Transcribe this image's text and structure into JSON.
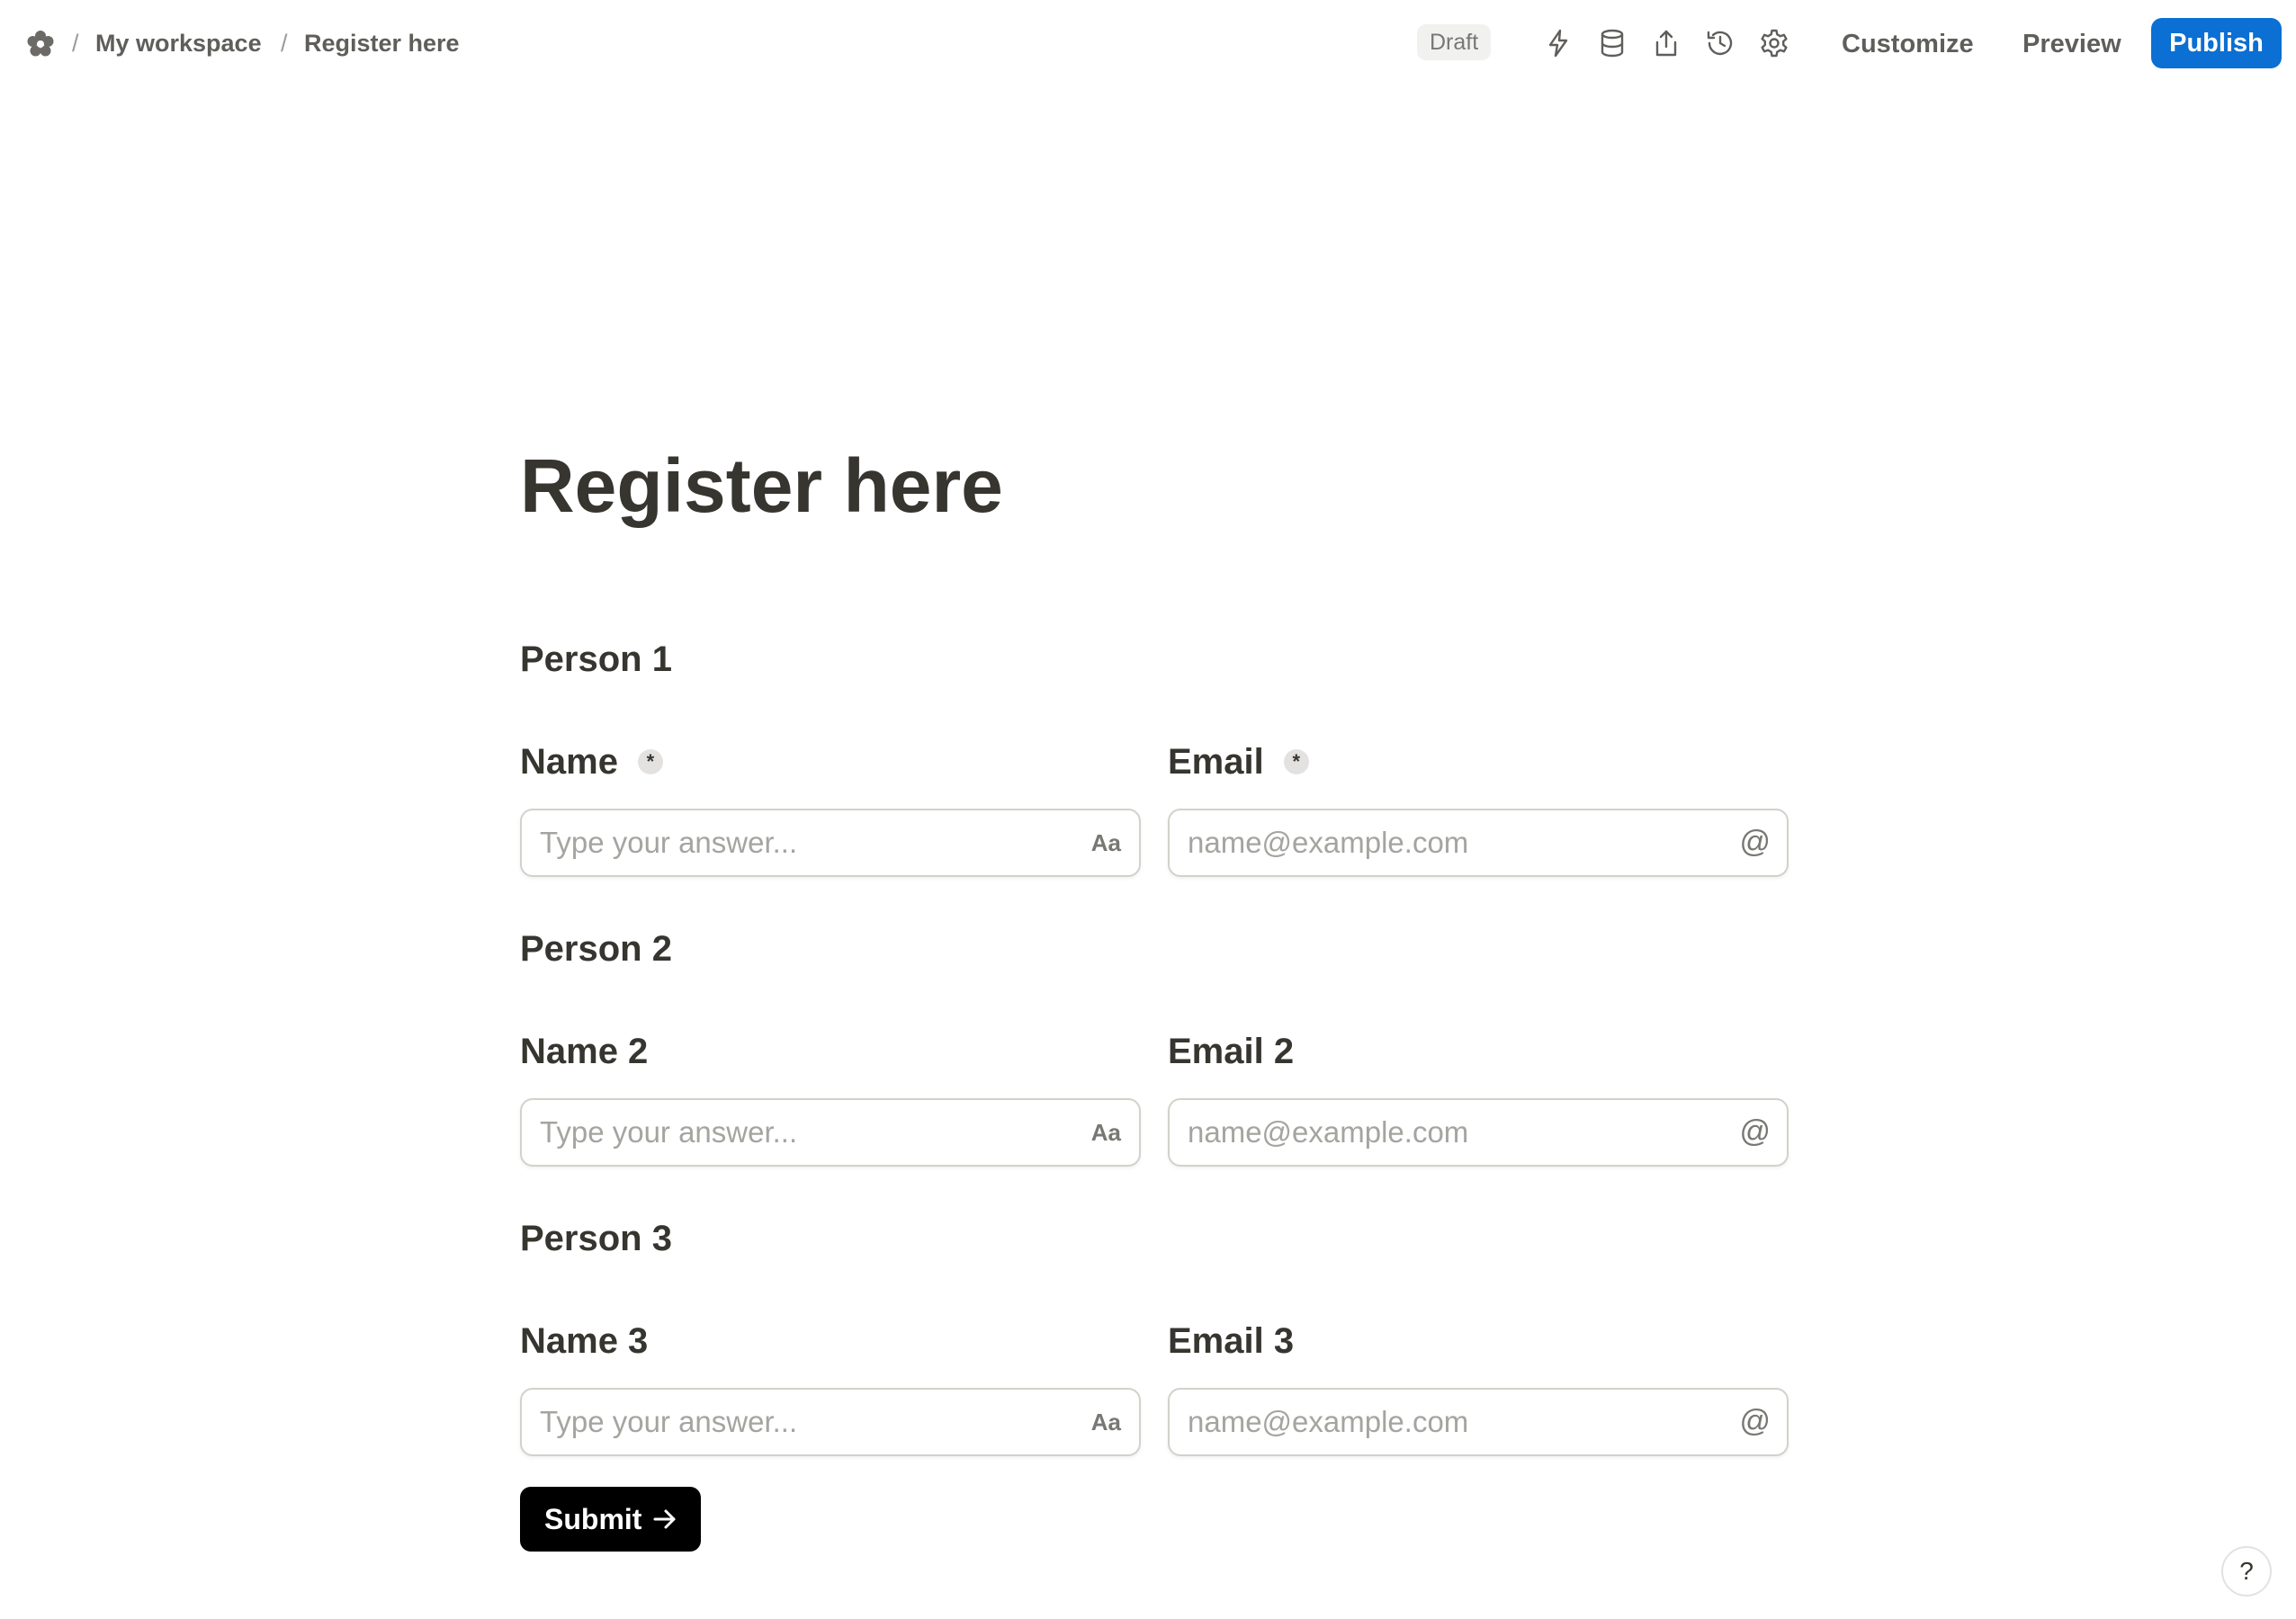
{
  "topbar": {
    "brand_icon": "flower-logo-icon",
    "breadcrumb": [
      {
        "label": "My workspace"
      },
      {
        "label": "Register here"
      }
    ],
    "separator": "/",
    "status_badge": "Draft",
    "icons": [
      "lightning-icon",
      "database-icon",
      "share-icon",
      "history-icon",
      "settings-icon"
    ],
    "customize_label": "Customize",
    "preview_label": "Preview",
    "publish_label": "Publish",
    "accent_color": "#0b6fd3"
  },
  "form": {
    "title": "Register here",
    "required_mark": "*",
    "sections": [
      {
        "heading": "Person 1",
        "name_label": "Name",
        "name_placeholder": "Type your answer...",
        "email_label": "Email",
        "email_placeholder": "name@example.com"
      },
      {
        "heading": "Person 2",
        "name_label": "Name 2",
        "name_placeholder": "Type your answer...",
        "email_label": "Email 2",
        "email_placeholder": "name@example.com"
      },
      {
        "heading": "Person 3",
        "name_label": "Name 3",
        "name_placeholder": "Type your answer...",
        "email_label": "Email 3",
        "email_placeholder": "name@example.com"
      }
    ],
    "text_field_icon": "Aa",
    "email_field_icon": "@",
    "submit_label": "Submit"
  },
  "help": {
    "label": "?"
  }
}
